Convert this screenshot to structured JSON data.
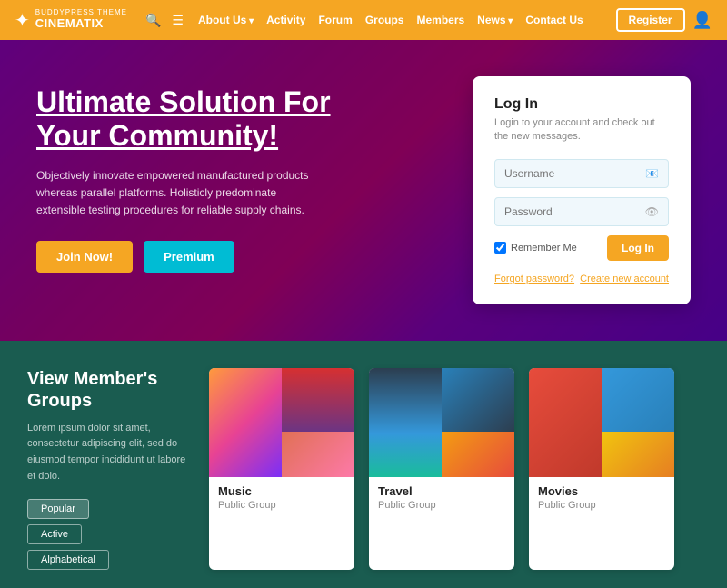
{
  "brand": {
    "sub": "BUDDYPRESS THEME",
    "name": "CINEMATIX",
    "icon": "✦"
  },
  "navbar": {
    "search_icon": "🔍",
    "menu_icon": "☰",
    "links": [
      {
        "label": "About Us",
        "has_arrow": true
      },
      {
        "label": "Activity",
        "has_arrow": false
      },
      {
        "label": "Forum",
        "has_arrow": false
      },
      {
        "label": "Groups",
        "has_arrow": false
      },
      {
        "label": "Members",
        "has_arrow": false
      },
      {
        "label": "News",
        "has_arrow": true
      },
      {
        "label": "Contact Us",
        "has_arrow": false
      }
    ],
    "register_label": "Register",
    "user_icon": "👤"
  },
  "hero": {
    "title": "Ultimate Solution For Your Community!",
    "description": "Objectively innovate empowered manufactured products whereas parallel platforms. Holisticly predominate extensible testing procedures for reliable supply chains.",
    "join_label": "Join Now!",
    "premium_label": "Premium"
  },
  "login": {
    "title": "Log In",
    "subtitle": "Login to your account and check out the new messages.",
    "username_placeholder": "Username",
    "password_placeholder": "Password",
    "remember_me": "Remember Me",
    "login_btn": "Log In",
    "forgot_password": "Forgot password?",
    "create_account": "Create new account"
  },
  "groups": {
    "title": "View Member's Groups",
    "description": "Lorem ipsum dolor sit amet, consectetur adipiscing elit, sed do eiusmod tempor incididunt ut labore et dolo.",
    "filters": [
      {
        "label": "Popular",
        "active": true
      },
      {
        "label": "Active",
        "active": false
      },
      {
        "label": "Alphabetical",
        "active": false
      }
    ],
    "cards": [
      {
        "name": "Music",
        "type": "Public Group"
      },
      {
        "name": "Travel",
        "type": "Public Group"
      },
      {
        "name": "Movies",
        "type": "Public Group"
      }
    ]
  }
}
